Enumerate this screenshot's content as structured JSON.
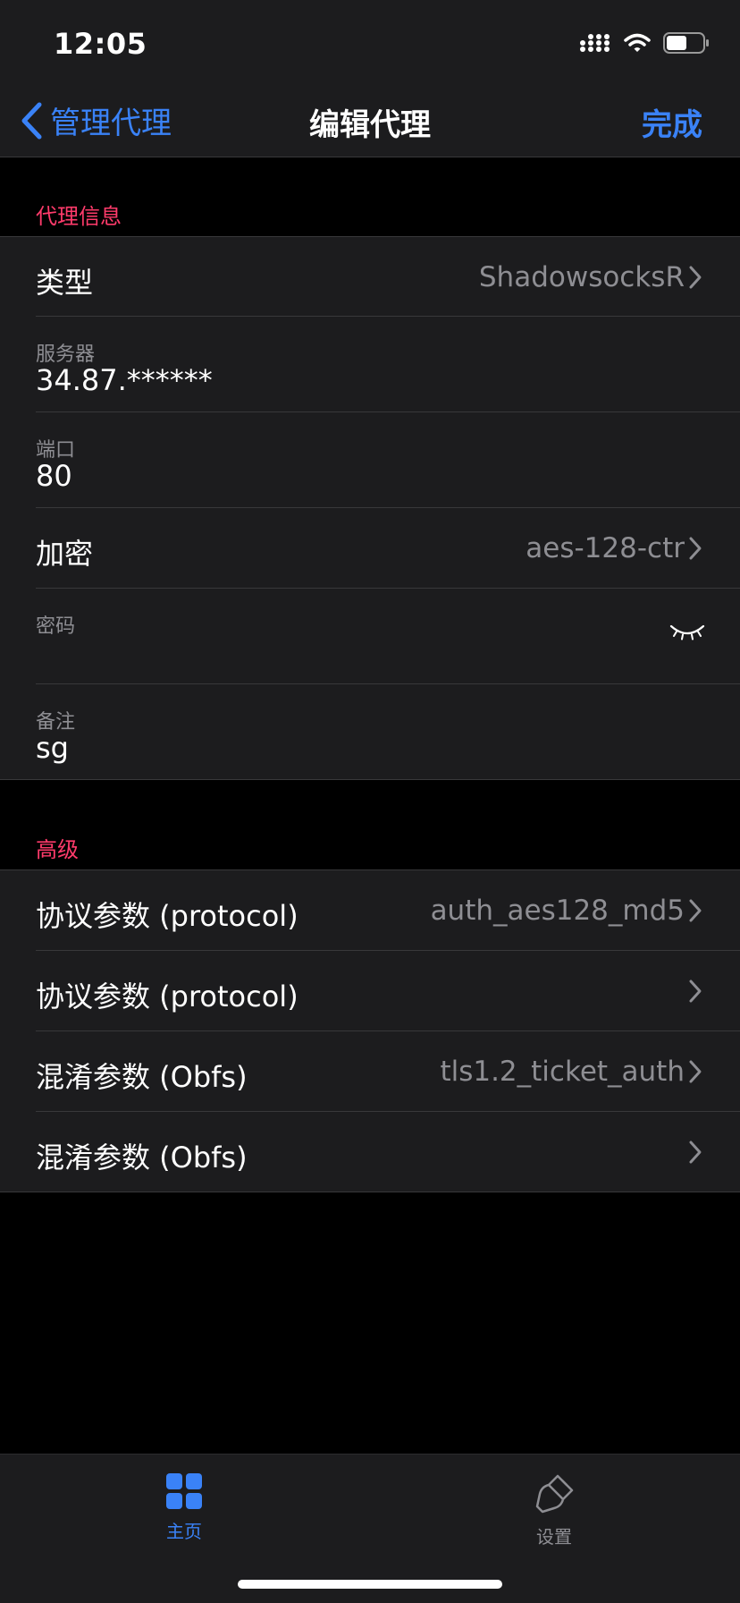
{
  "status_bar": {
    "time": "12:05"
  },
  "nav": {
    "back_label": "管理代理",
    "title": "编辑代理",
    "done_label": "完成"
  },
  "proxy_info": {
    "header": "代理信息",
    "type": {
      "label": "类型",
      "value": "ShadowsocksR"
    },
    "server": {
      "label": "服务器",
      "value": "34.87.******"
    },
    "port": {
      "label": "端口",
      "value": "80"
    },
    "encryption": {
      "label": "加密",
      "value": "aes-128-ctr"
    },
    "password": {
      "label": "密码",
      "value": ""
    },
    "remark": {
      "label": "备注",
      "value": "sg"
    }
  },
  "advanced": {
    "header": "高级",
    "rows": [
      {
        "label": "协议参数 (protocol)",
        "value": "auth_aes128_md5"
      },
      {
        "label": "协议参数 (protocol)",
        "value": ""
      },
      {
        "label": "混淆参数 (Obfs)",
        "value": "tls1.2_ticket_auth"
      },
      {
        "label": "混淆参数 (Obfs)",
        "value": ""
      }
    ]
  },
  "tab_bar": {
    "tabs": [
      {
        "label": "主页",
        "icon": "grid-icon",
        "active": true
      },
      {
        "label": "设置",
        "icon": "brush-icon",
        "active": false
      }
    ]
  },
  "colors": {
    "accent": "#3a82f7",
    "section_header": "#ff3b6b",
    "background": "#000000",
    "cell": "#1c1c1e",
    "secondary_text": "#8e8e93"
  }
}
